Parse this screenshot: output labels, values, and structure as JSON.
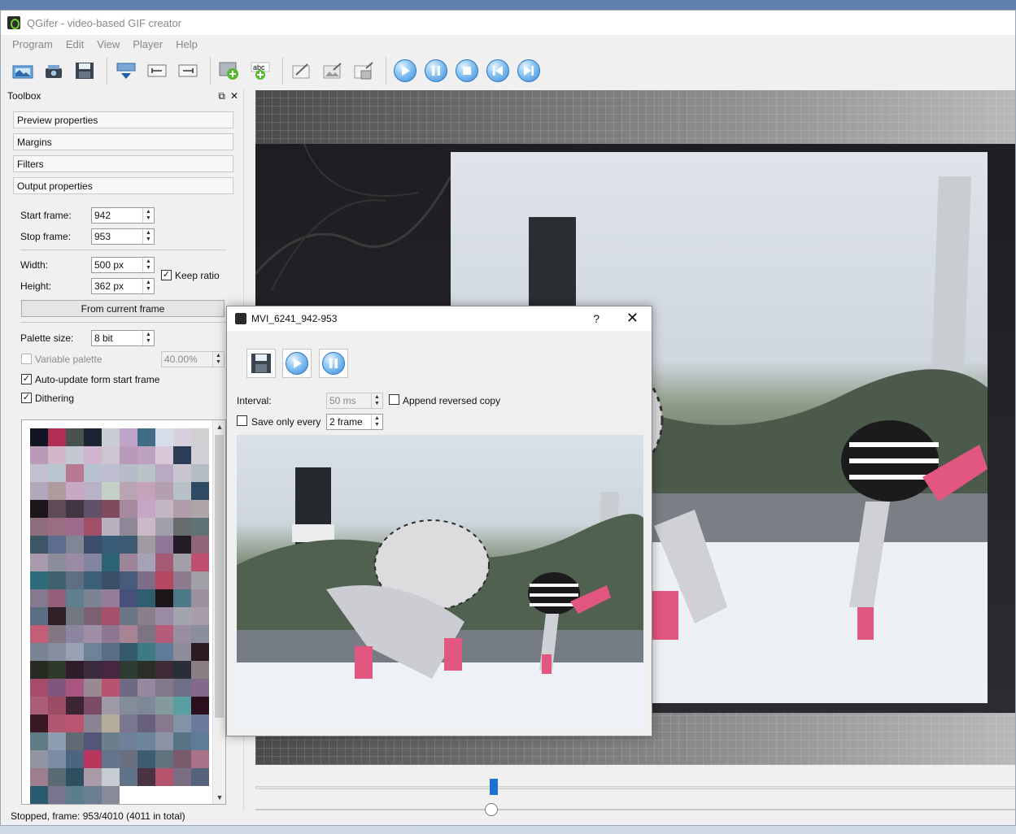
{
  "window": {
    "title": "QGifer - video-based GIF creator"
  },
  "menu": [
    "Program",
    "Edit",
    "View",
    "Player",
    "Help"
  ],
  "toolbar": {
    "buttons": [
      "open-video-icon",
      "extract-gif-icon",
      "save-icon",
      "frame-down-icon",
      "set-start-icon",
      "set-end-icon",
      "add-object-icon",
      "add-text-icon",
      "draw-icon",
      "image-edit-icon",
      "crop-icon",
      "play-icon",
      "pause-icon",
      "stop-icon",
      "prev-frame-icon",
      "next-frame-icon"
    ]
  },
  "toolbox": {
    "title": "Toolbox",
    "sections": [
      "Preview properties",
      "Margins",
      "Filters",
      "Output properties"
    ],
    "start_frame_label": "Start frame:",
    "start_frame": "942",
    "stop_frame_label": "Stop frame:",
    "stop_frame": "953",
    "width_label": "Width:",
    "width": "500 px",
    "height_label": "Height:",
    "height": "362 px",
    "keep_ratio_label": "Keep ratio",
    "keep_ratio": true,
    "from_current_frame": "From current frame",
    "palette_size_label": "Palette size:",
    "palette_size": "8 bit",
    "variable_palette_label": "Variable palette",
    "variable_palette_value": "40.00%",
    "auto_update_label": "Auto-update form start frame",
    "dithering_label": "Dithering",
    "palette_colors": [
      "#121624",
      "#b12f55",
      "#47524d",
      "#1c2434",
      "#c9ced4",
      "#c0a3c8",
      "#3f6d86",
      "#d7dde8",
      "#d6d1dd",
      "#d0cfd2",
      "#b99ab8",
      "#d2b7c9",
      "#c3c8d2",
      "#d1b4d0",
      "#cdc6d1",
      "#b79ab9",
      "#bda2bf",
      "#d7c7d8",
      "#2c3d55",
      "#d2d0d6",
      "#c4bfd0",
      "#b7c5cf",
      "#b77a92",
      "#b8c3d2",
      "#bebed0",
      "#b5bcc8",
      "#b9c3c7",
      "#b9a9c3",
      "#c9c6d2",
      "#b4bdc6",
      "#b1a8bd",
      "#ae9b9e",
      "#c7a8c5",
      "#b9b1c5",
      "#c2d0c5",
      "#b9a5b2",
      "#c4a2b9",
      "#b49fb0",
      "#b8c0c7",
      "#2e4a63",
      "#1a1518",
      "#5e4b55",
      "#413641",
      "#625166",
      "#7f4b5d",
      "#a58aa0",
      "#c5a6c4",
      "#c4b7c3",
      "#af9ea9",
      "#aea5a7",
      "#8c6d7c",
      "#9a6d82",
      "#9f6b8d",
      "#a14f69",
      "#b9b0c0",
      "#8d8898",
      "#cbb8c8",
      "#a09fac",
      "#676b6e",
      "#5f7376",
      "#3e5564",
      "#5c6d8f",
      "#818694",
      "#3b4f6d",
      "#3a5d77",
      "#3f5b72",
      "#9e9ca1",
      "#8f7797",
      "#241c26",
      "#8f6577",
      "#a89aac",
      "#8b8d9b",
      "#9b8aa3",
      "#83859e",
      "#2d6473",
      "#9d8498",
      "#a3a2b7",
      "#a55a73",
      "#a39fa7",
      "#be4f70",
      "#2f6b7a",
      "#41606d",
      "#5f6f83",
      "#3a5f76",
      "#3c4f68",
      "#475b7a",
      "#7e6d87",
      "#b4465f",
      "#8e7b8c",
      "#a1a0a6",
      "#85798f",
      "#945f78",
      "#5e7f8c",
      "#7c8393",
      "#947e97",
      "#46517a",
      "#2e5e70",
      "#1a1519",
      "#4e7988",
      "#9b91a0",
      "#5b6e81",
      "#2f1f27",
      "#727881",
      "#7d5f72",
      "#a54f6a",
      "#6b7686",
      "#8c7d8b",
      "#9a8aa3",
      "#a1a4ae",
      "#a89da8",
      "#c25f77",
      "#837683",
      "#8b85a0",
      "#9e8ea6",
      "#8e7792",
      "#a88393",
      "#7d7483",
      "#b45c78",
      "#9a8ea2",
      "#8b8f9d",
      "#798495",
      "#888ea0",
      "#97a1b3",
      "#6e8397",
      "#586f87",
      "#355a6b",
      "#3c7b83",
      "#5e7b9a",
      "#8f8c9a",
      "#2a1c22",
      "#262a23",
      "#2f3a2a",
      "#2f1c2b",
      "#3b2b3e",
      "#472640",
      "#2e3b33",
      "#2c2f27",
      "#3f2b38",
      "#2a2e37",
      "#8a7f84",
      "#a74b6a",
      "#7f567e",
      "#a9577f",
      "#9a8892",
      "#b8546f",
      "#6e6a83",
      "#95889f",
      "#81798b",
      "#6f7088",
      "#826b8a",
      "#aa5d76",
      "#9b4b64",
      "#3c2633",
      "#7b4a66",
      "#9d9aa5",
      "#848b99",
      "#7e8896",
      "#849a9d",
      "#599ea1",
      "#2b0f1c",
      "#3a1823",
      "#b0566e",
      "#ba5470",
      "#8c8395",
      "#b4ad99",
      "#7c7790",
      "#67607c",
      "#87788d",
      "#8293a6",
      "#6b7a9f",
      "#5f7b85",
      "#8a9cad",
      "#616a72",
      "#555677",
      "#6a7e8c",
      "#70809b",
      "#6e869b",
      "#8c92a5",
      "#597386",
      "#5e7c95",
      "#90959f",
      "#7a8da4",
      "#4c6480",
      "#b8355d",
      "#63748b",
      "#6b6f80",
      "#3e5c6f",
      "#62737e",
      "#7a5a6d",
      "#a97289",
      "#9d7e8f",
      "#5b6b73",
      "#2d5061",
      "#a89aa7",
      "#c7cbd2",
      "#607389",
      "#4a3342",
      "#b6546e",
      "#7c6e82",
      "#57637c",
      "#2b5a6e",
      "#7b748e",
      "#5c7d8c",
      "#6b7f91",
      "#878b99"
    ]
  },
  "status": {
    "text": "Stopped, frame: 953/4010 (4011 in total)"
  },
  "dialog": {
    "title": "MVI_6241_942-953",
    "help": "?",
    "close": "✕",
    "interval_label": "Interval:",
    "interval": "50 ms",
    "append_reversed_label": "Append reversed copy",
    "save_only_every_label": "Save only every",
    "save_only_every": "2 frame"
  },
  "player": {
    "seek_fraction": 0.3125,
    "position_fraction": 0.31
  }
}
